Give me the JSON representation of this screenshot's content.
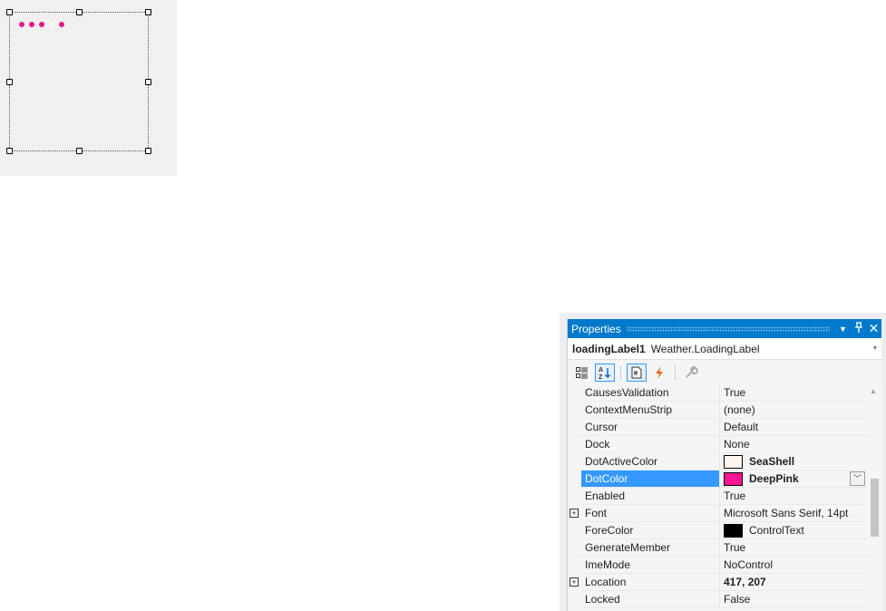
{
  "designer": {
    "dots": [
      {
        "state": "normal",
        "color": "#e8168a"
      },
      {
        "state": "normal",
        "color": "#e8168a"
      },
      {
        "state": "normal",
        "color": "#e8168a"
      },
      {
        "state": "active",
        "color": "#fff5ee"
      },
      {
        "state": "normal",
        "color": "#e8168a"
      }
    ]
  },
  "properties": {
    "title": "Properties",
    "buttons": {
      "dropdown": "▼",
      "pin": "📌",
      "close": "✕"
    },
    "object": {
      "name": "loadingLabel1",
      "type": "Weather.LoadingLabel"
    },
    "toolbar": [
      {
        "name": "categorized-button",
        "icon": "categorized-icon",
        "glyph": "☷",
        "active": false
      },
      {
        "name": "alphabetical-button",
        "icon": "sort-az-icon",
        "glyph": "A↓",
        "active": true
      },
      {
        "name": "properties-button",
        "icon": "properties-icon",
        "glyph": "🗋",
        "active": true
      },
      {
        "name": "events-button",
        "icon": "lightning-icon",
        "glyph": "⚡",
        "active": false
      },
      {
        "name": "property-pages-button",
        "icon": "wrench-icon",
        "glyph": "🔧",
        "active": false
      }
    ],
    "rows": [
      {
        "name": "CausesValidation",
        "value": "True"
      },
      {
        "name": "ContextMenuStrip",
        "value": "(none)"
      },
      {
        "name": "Cursor",
        "value": "Default"
      },
      {
        "name": "Dock",
        "value": "None"
      },
      {
        "name": "DotActiveColor",
        "value": "SeaShell",
        "swatch": "#fff5ee",
        "bold": true
      },
      {
        "name": "DotColor",
        "value": "DeepPink",
        "swatch": "#ff1493",
        "bold": true,
        "selected": true
      },
      {
        "name": "Enabled",
        "value": "True"
      },
      {
        "name": "Font",
        "value": "Microsoft Sans Serif, 14pt",
        "expandable": true
      },
      {
        "name": "ForeColor",
        "value": "ControlText",
        "swatch": "#000000"
      },
      {
        "name": "GenerateMember",
        "value": "True"
      },
      {
        "name": "ImeMode",
        "value": "NoControl"
      },
      {
        "name": "Location",
        "value": "417, 207",
        "expandable": true,
        "bold": true
      },
      {
        "name": "Locked",
        "value": "False"
      }
    ]
  }
}
